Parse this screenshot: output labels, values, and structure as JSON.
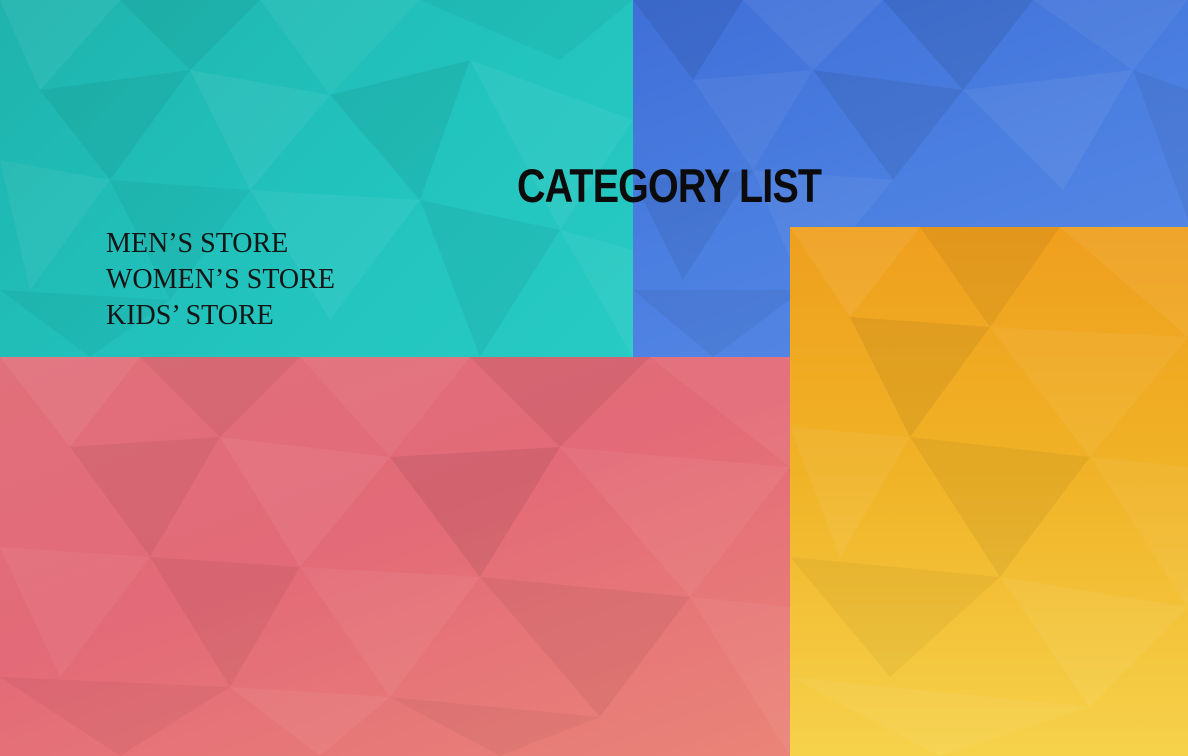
{
  "page": {
    "heading": "CATEGORY LIST",
    "categories": [
      {
        "label": "MEN’S STORE"
      },
      {
        "label": "WOMEN’S STORE"
      },
      {
        "label": "KIDS’ STORE"
      }
    ]
  },
  "colors": {
    "teal_panel": "#22c3bd",
    "blue_panel": "#4b7fe0",
    "red_panel": "#e36a78",
    "yellow_panel": "#f0b226",
    "text": "#0b0b0b"
  }
}
